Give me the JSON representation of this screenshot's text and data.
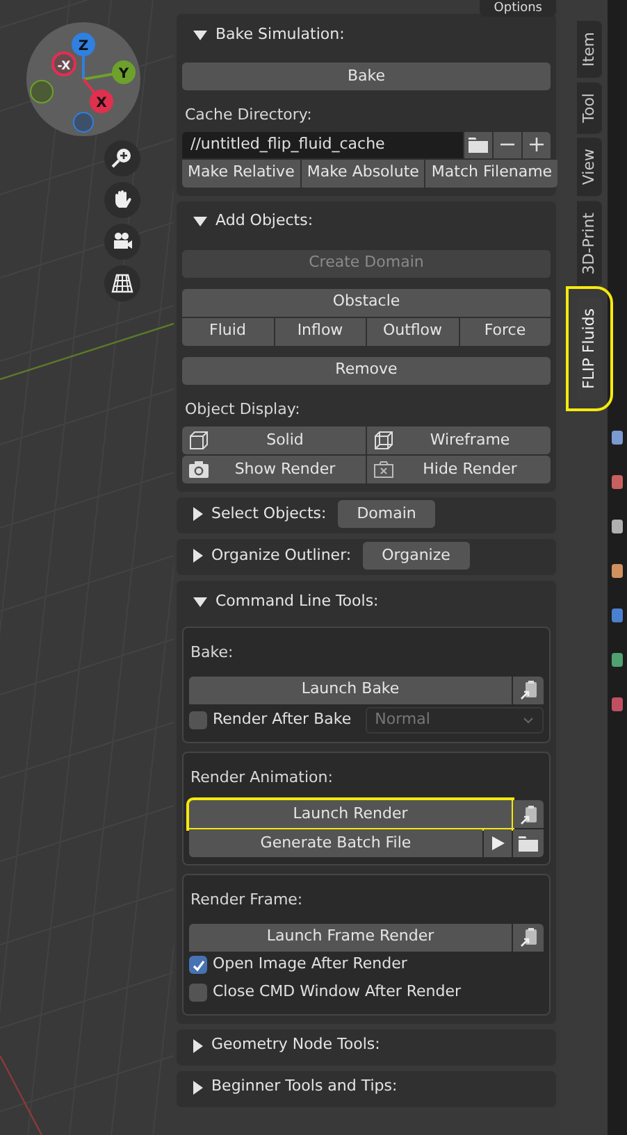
{
  "header": {
    "options_button": "Options"
  },
  "gizmo": {
    "axes": [
      {
        "label": "Z",
        "kind": "positive",
        "color": "#2f80e0"
      },
      {
        "label": "-X",
        "kind": "negative",
        "color": "#e0304e"
      },
      {
        "label": "Y",
        "kind": "positive",
        "color": "#6ea12c"
      },
      {
        "label": "X",
        "kind": "positive",
        "color": "#e0304e"
      }
    ]
  },
  "sidebar_tabs": [
    {
      "label": "Item",
      "selected": false,
      "highlighted": false
    },
    {
      "label": "Tool",
      "selected": false,
      "highlighted": false
    },
    {
      "label": "View",
      "selected": false,
      "highlighted": false
    },
    {
      "label": "3D-Print",
      "selected": false,
      "highlighted": false
    },
    {
      "label": "FLIP Fluids",
      "selected": true,
      "highlighted": true
    }
  ],
  "panels": [
    {
      "title": "Bake Simulation:",
      "expanded": true,
      "rows": [
        {
          "kind": "button",
          "label": "Bake",
          "disabled": false
        },
        {
          "kind": "label",
          "text": "Cache Directory:"
        },
        {
          "kind": "path_field",
          "value": "//untitled_flip_fluid_cache"
        },
        {
          "kind": "button_row",
          "buttons": [
            "Make Relative",
            "Make Absolute",
            "Match Filename"
          ]
        }
      ]
    },
    {
      "title": "Add Objects:",
      "expanded": true,
      "rows": [
        {
          "kind": "button",
          "label": "Create Domain",
          "disabled": true
        },
        {
          "kind": "button",
          "label": "Obstacle",
          "disabled": false
        },
        {
          "kind": "button_row",
          "buttons": [
            "Fluid",
            "Inflow",
            "Outflow",
            "Force"
          ]
        },
        {
          "kind": "button",
          "label": "Remove",
          "disabled": false
        },
        {
          "kind": "label",
          "text": "Object Display:"
        },
        {
          "kind": "icon_button_row",
          "buttons": [
            {
              "label": "Solid"
            },
            {
              "label": "Wireframe"
            }
          ]
        },
        {
          "kind": "icon_button_row",
          "buttons": [
            {
              "label": "Show Render"
            },
            {
              "label": "Hide Render"
            }
          ]
        }
      ]
    },
    {
      "title": "Select Objects:",
      "expanded": false,
      "button": "Domain"
    },
    {
      "title": "Organize Outliner:",
      "expanded": false,
      "button": "Organize"
    },
    {
      "title": "Command Line Tools:",
      "expanded": true,
      "rows": [
        {
          "kind": "subpanel",
          "title": "Bake:",
          "rows": [
            {
              "kind": "launch",
              "label": "Launch Bake",
              "highlighted": false
            },
            {
              "kind": "checkbox_dropdown",
              "label": "Render After Bake",
              "checked": false,
              "value": "Normal",
              "disabled": true
            }
          ]
        },
        {
          "kind": "subpanel",
          "title": "Render Animation:",
          "rows": [
            {
              "kind": "launch",
              "label": "Launch Render",
              "highlighted": true
            },
            {
              "kind": "batch",
              "label": "Generate Batch File"
            }
          ]
        },
        {
          "kind": "subpanel",
          "title": "Render Frame:",
          "rows": [
            {
              "kind": "launch",
              "label": "Launch Frame Render",
              "highlighted": false
            },
            {
              "kind": "checkbox",
              "label": "Open Image After Render",
              "checked": true
            },
            {
              "kind": "checkbox",
              "label": "Close CMD Window After Render",
              "checked": false
            }
          ]
        }
      ]
    },
    {
      "title": "Geometry Node Tools:",
      "expanded": false
    },
    {
      "title": "Beginner Tools and Tips:",
      "expanded": false
    }
  ]
}
